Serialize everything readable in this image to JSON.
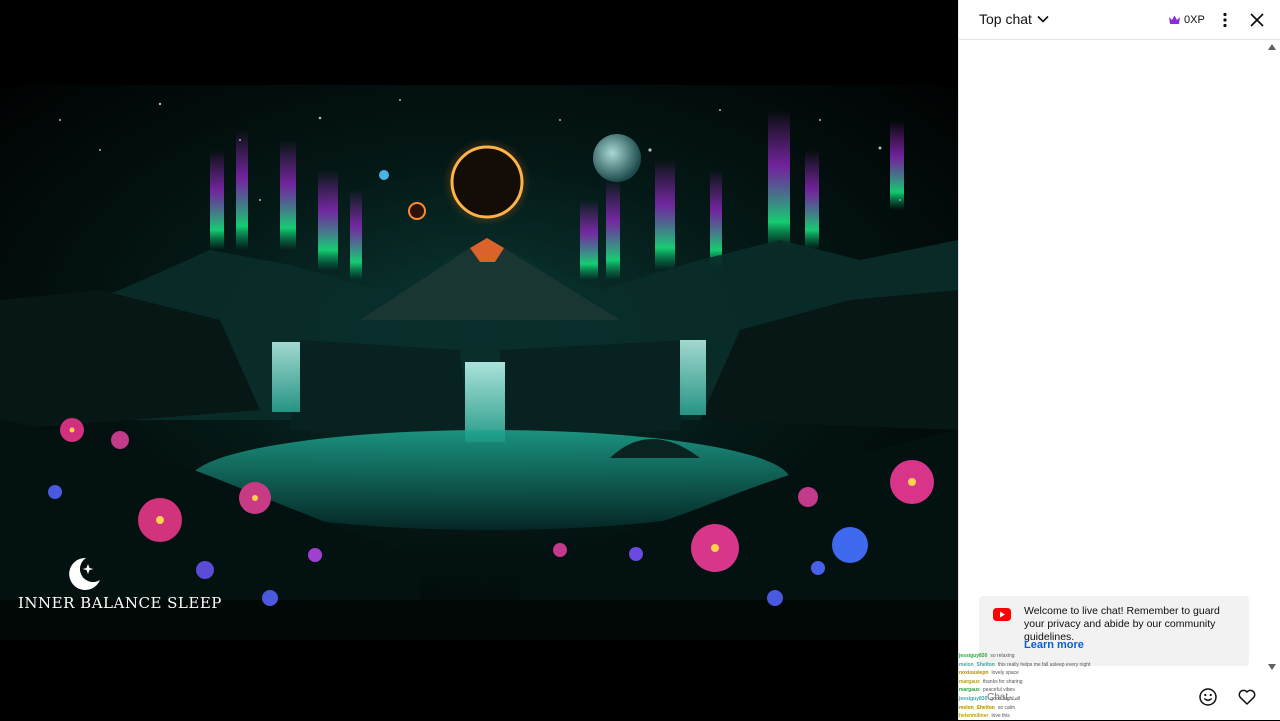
{
  "video": {
    "watermark_text": "INNER BALANCE SLEEP"
  },
  "chat": {
    "mode_label": "Top chat",
    "xp_label": "0XP",
    "welcome_text": "Welcome to live chat! Remember to guard your privacy and abide by our community guidelines.",
    "learn_more_label": "Learn more",
    "input_placeholder": "Chat...",
    "messages": [
      {
        "author": "jessiguy830",
        "text": "so relaxing"
      },
      {
        "author": "melon_Shelton",
        "text": "this really helps me fall asleep every night"
      },
      {
        "author": "noxiouslepn",
        "text": "lovely space"
      },
      {
        "author": "margaux",
        "text": "thanks for sharing"
      },
      {
        "author": "margaux",
        "text": "peaceful vibes"
      },
      {
        "author": "jessiguy830",
        "text": "good night all"
      },
      {
        "author": "melon_Shelton",
        "text": "so calm"
      },
      {
        "author": "helenmillner",
        "text": "love this"
      }
    ]
  },
  "colors": {
    "accent_link": "#065fd4",
    "youtube_red": "#ff0000",
    "crown_purple": "#8b2dd8"
  }
}
